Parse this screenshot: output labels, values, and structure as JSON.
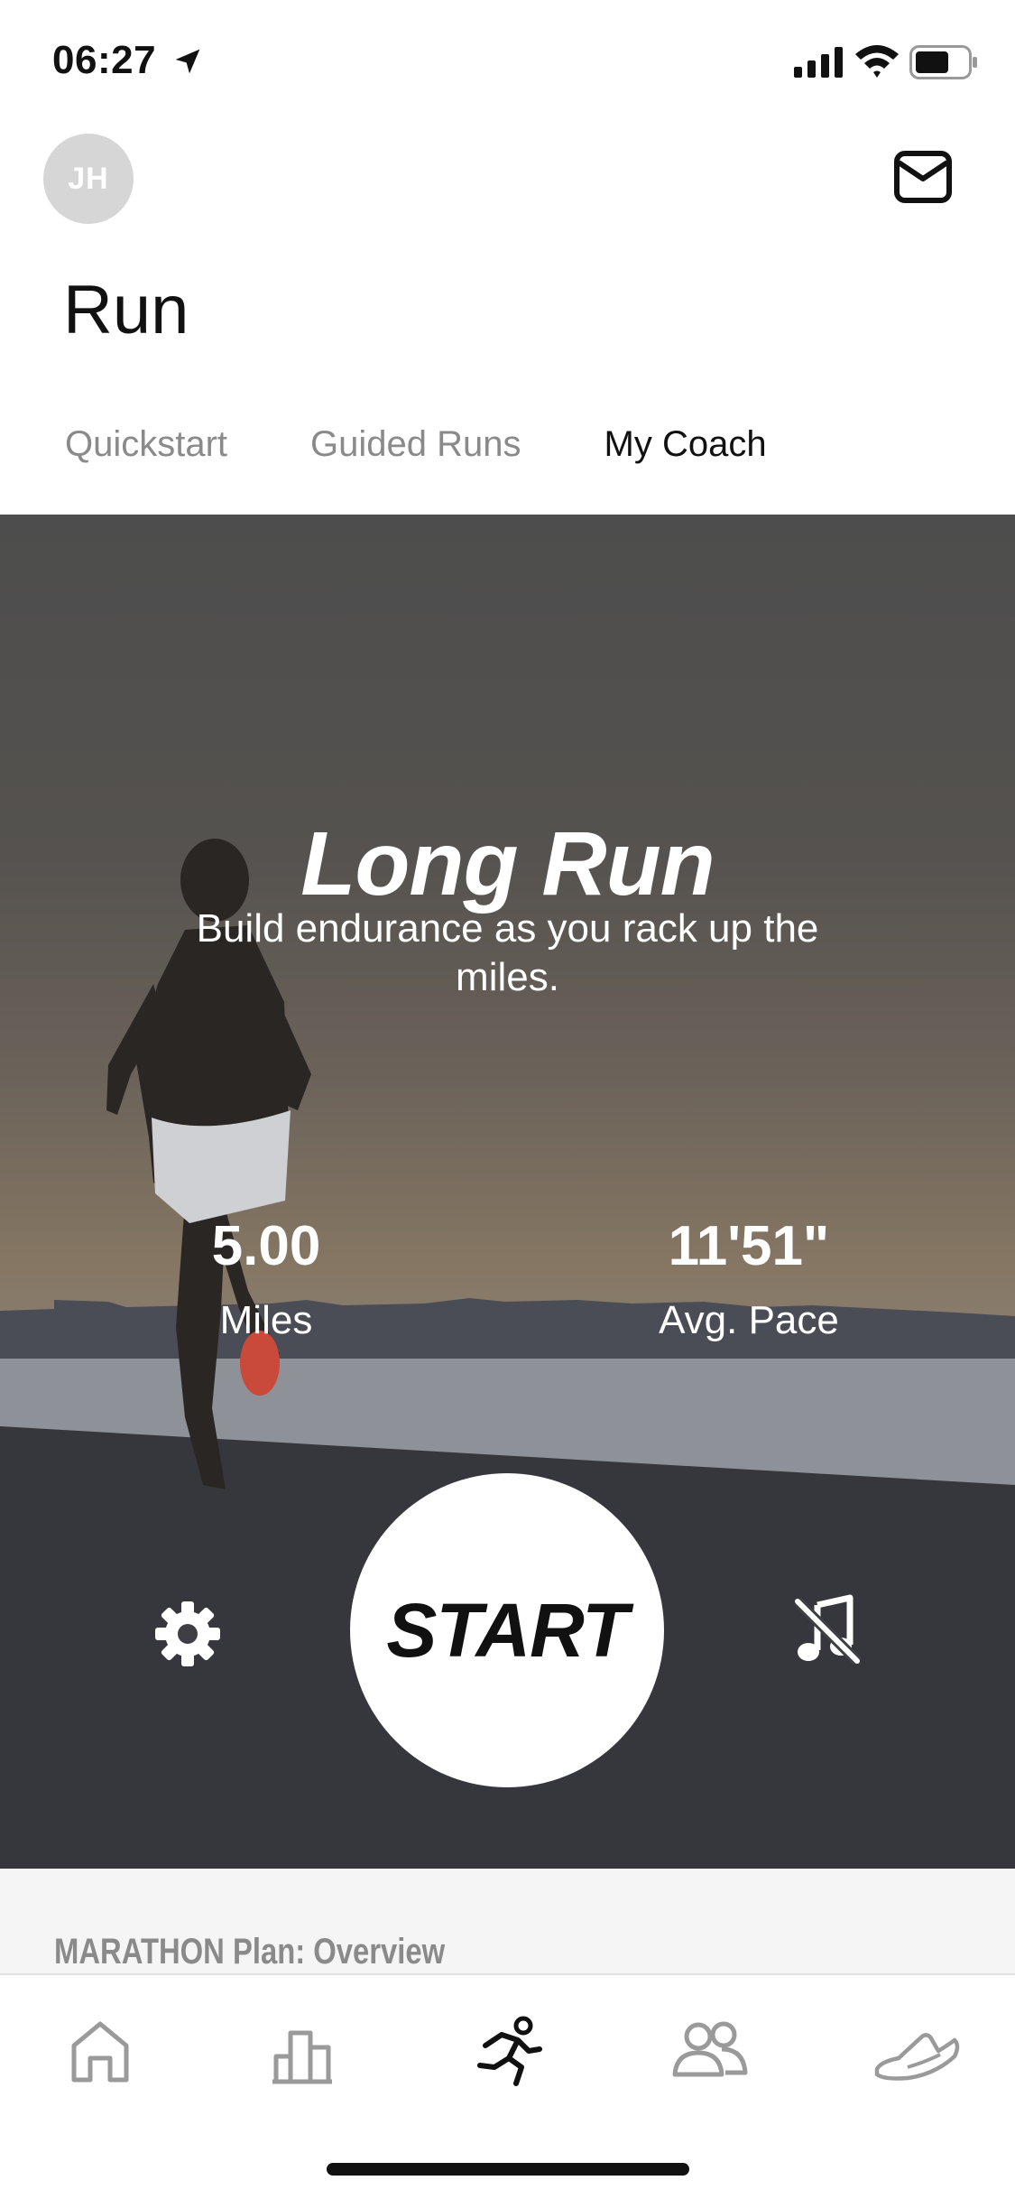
{
  "status_bar": {
    "time": "06:27"
  },
  "header": {
    "avatar_initials": "JH",
    "title": "Run"
  },
  "tabs": [
    {
      "label": "Quickstart",
      "active": false
    },
    {
      "label": "Guided Runs",
      "active": false
    },
    {
      "label": "My Coach",
      "active": true
    }
  ],
  "hero": {
    "title": "Long Run",
    "subtitle": "Build endurance as you rack up the miles.",
    "stats": [
      {
        "value": "5.00",
        "label": "Miles"
      },
      {
        "value": "11'51\"",
        "label": "Avg. Pace"
      }
    ],
    "start_label": "START"
  },
  "plan": {
    "title": "MARATHON Plan: Overview"
  },
  "tab_bar": {
    "icons": [
      "home-icon",
      "activity-icon",
      "run-icon",
      "club-icon",
      "shoe-icon"
    ]
  },
  "colors": {
    "accent": "#111111",
    "inactive": "#8a8a8a",
    "background": "#ffffff"
  }
}
